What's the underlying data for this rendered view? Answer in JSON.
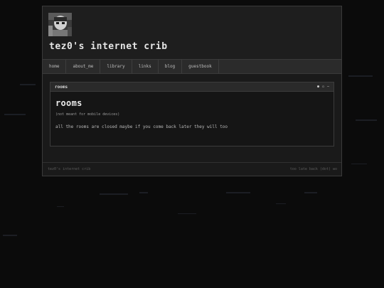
{
  "header": {
    "title": "tez0's internet crib",
    "avatar_icon": "grayscale-portrait-avatar"
  },
  "nav": {
    "items": [
      {
        "label": "home"
      },
      {
        "label": "about_me"
      },
      {
        "label": "library"
      },
      {
        "label": "links"
      },
      {
        "label": "blog"
      },
      {
        "label": "guestbook"
      }
    ]
  },
  "window": {
    "titlebar_label": "rooms",
    "controls": {
      "minimize_icon": "dot-icon",
      "maximize_icon": "square-icon",
      "close_icon": "dash-icon",
      "minimize": "●",
      "maximize": "▫",
      "close": "–"
    },
    "heading": "rooms",
    "note": "(not meant for mobile devices)",
    "body": "all the rooms are closed maybe if you come back later they will too"
  },
  "footer": {
    "left": "tez0's internet crib",
    "right": "too late back (dot) wo"
  },
  "colors": {
    "page_background": "#0b0b0b",
    "panel_background": "#1a1a1a",
    "nav_background": "#2b2b2b",
    "text_primary": "#e6e6e6"
  }
}
